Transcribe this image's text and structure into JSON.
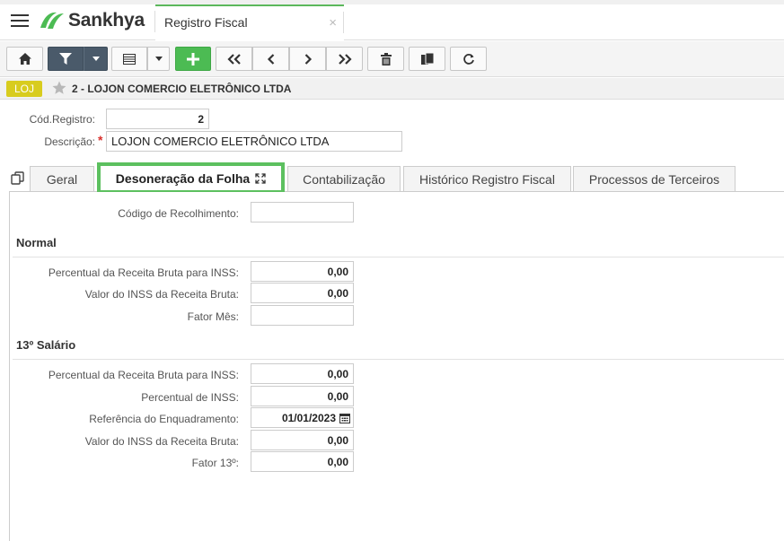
{
  "app": {
    "logo_text": "Sankhya",
    "tab_title": "Registro Fiscal",
    "tab_close": "×"
  },
  "toolbar": {
    "buttons": [
      "home-icon",
      "filter-icon",
      "caret-down-icon",
      "grid-view-icon",
      "caret-down-icon",
      "plus-icon",
      "first-record-icon",
      "previous-record-icon",
      "next-record-icon",
      "last-record-icon",
      "trash-icon",
      "duplicate-icon",
      "refresh-icon"
    ]
  },
  "record": {
    "badge": "LOJ",
    "title": "2 - LOJON COMERCIO ELETRÔNICO LTDA"
  },
  "header_form": {
    "cod_label": "Cód.Registro:",
    "cod_value": "2",
    "desc_label": "Descrição:",
    "desc_required": "*",
    "desc_value": "LOJON COMERCIO ELETRÔNICO LTDA"
  },
  "tabs": [
    {
      "label": "Geral"
    },
    {
      "label": "Desoneração da Folha"
    },
    {
      "label": "Contabilização"
    },
    {
      "label": "Histórico Registro Fiscal"
    },
    {
      "label": "Processos de Terceiros"
    }
  ],
  "form": {
    "codigo_recolhimento_label": "Código de Recolhimento:",
    "codigo_recolhimento_value": "",
    "normal": {
      "title": "Normal",
      "fields": [
        {
          "label": "Percentual da Receita Bruta para INSS:",
          "value": "0,00"
        },
        {
          "label": "Valor do INSS da Receita Bruta:",
          "value": "0,00"
        },
        {
          "label": "Fator Mês:",
          "value": ""
        }
      ]
    },
    "salario13": {
      "title": "13º Salário",
      "fields": [
        {
          "label": "Percentual da Receita Bruta para INSS:",
          "value": "0,00"
        },
        {
          "label": "Percentual de INSS:",
          "value": "0,00"
        },
        {
          "label": "Referência do Enquadramento:",
          "value": "01/01/2023"
        },
        {
          "label": "Valor do INSS da Receita Bruta:",
          "value": "0,00"
        },
        {
          "label": "Fator 13º:",
          "value": "0,00"
        }
      ]
    }
  },
  "colors": {
    "accent_green": "#5cc05f",
    "badge_yellow": "#d8cc1e",
    "required_red": "#d9302c",
    "toolbar_dark": "#4a5a6a"
  }
}
